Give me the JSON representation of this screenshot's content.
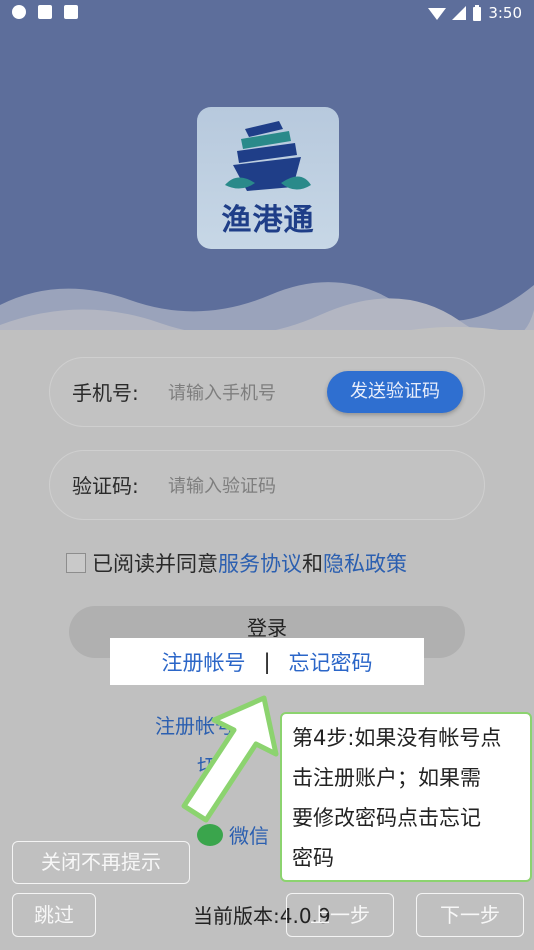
{
  "status_bar": {
    "time": "3:50"
  },
  "logo": {
    "app_name": "渔港通"
  },
  "phone_field": {
    "label": "手机号:",
    "placeholder": "请输入手机号",
    "send_code_label": "发送验证码"
  },
  "code_field": {
    "label": "验证码:",
    "placeholder": "请输入验证码"
  },
  "agreement": {
    "prefix": "已阅读并同意",
    "terms_link": "服务协议",
    "and": "和",
    "privacy_link": "隐私政策"
  },
  "login_label": "登录",
  "highlight": {
    "register_label": "注册帐号",
    "separator": "|",
    "forgot_label": "忘记密码"
  },
  "behind": {
    "register": "注册帐号",
    "switch": "切换",
    "wechat": "微信"
  },
  "tooltip": {
    "line1": "第4步:如果没有帐号点",
    "line2": "击注册账户；如果需",
    "line3": "要修改密码点击忘记",
    "line4": "密码"
  },
  "footer": {
    "close_hint_label": "关闭不再提示",
    "skip_label": "跳过",
    "version_text": "当前版本:4.0.9",
    "prev_label": "上一步",
    "next_label": "下一步"
  },
  "colors": {
    "header": "#5d6e9b",
    "accent": "#2f6fd0",
    "link": "#2b5fb0",
    "tooltip_border": "#8cd36f"
  }
}
